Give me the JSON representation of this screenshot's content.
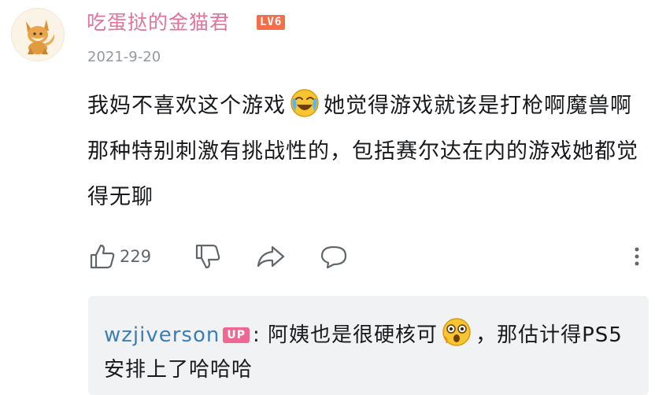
{
  "comment": {
    "avatar_icon": "fox-avatar-icon",
    "username": "吃蛋挞的金猫君",
    "level_badge": "LV6",
    "date": "2021-9-20",
    "text_part1": "我妈不喜欢这个游戏",
    "emoji1": "laughing-crying-emoji-icon",
    "text_part2": "她觉得游戏就该是打枪啊魔兽啊那种特别刺激有挑战性的，包括赛尔达在内的游戏她都觉得无聊"
  },
  "actions": {
    "like_count": "229",
    "like_icon": "thumbs-up-icon",
    "dislike_icon": "thumbs-down-icon",
    "share_icon": "share-icon",
    "reply_icon": "comment-bubble-icon",
    "more_icon": "more-vertical-icon"
  },
  "reply": {
    "username": "wzjiverson",
    "up_badge": "UP",
    "separator": ":",
    "text_part1": "阿姨也是很硬核可",
    "emoji": "surprised-emoji-icon",
    "text_part2": "，那估计得PS5安排上了哈哈哈"
  },
  "colors": {
    "username_pink": "#e2739a",
    "level_orange": "#f36f4a",
    "reply_user_blue": "#3d7fb5",
    "up_badge_pink": "#ef6793",
    "reply_bg": "#f1f2f3",
    "meta_gray": "#9499a0"
  }
}
